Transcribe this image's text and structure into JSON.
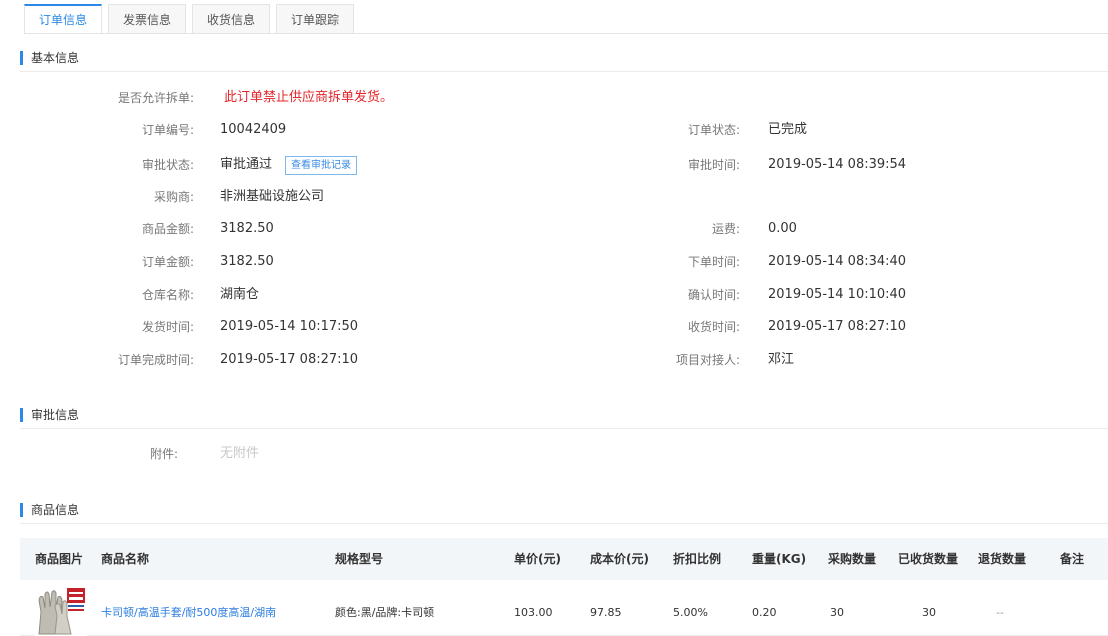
{
  "tabs": [
    "订单信息",
    "发票信息",
    "收货信息",
    "订单跟踪"
  ],
  "sections": {
    "basic": "基本信息",
    "approval": "审批信息",
    "goods": "商品信息"
  },
  "basic": {
    "split_label": "是否允许拆单:",
    "split_value": "此订单禁止供应商拆单发货。",
    "order_no_label": "订单编号:",
    "order_no_value": "10042409",
    "order_status_label": "订单状态:",
    "order_status_value": "已完成",
    "approval_status_label": "审批状态:",
    "approval_status_value": "审批通过",
    "approval_record_button": "查看审批记录",
    "approval_time_label": "审批时间:",
    "approval_time_value": "2019-05-14 08:39:54",
    "buyer_label": "采购商:",
    "buyer_value": "非洲基础设施公司",
    "goods_amount_label": "商品金额:",
    "goods_amount_value": "3182.50",
    "freight_label": "运费:",
    "freight_value": "0.00",
    "order_amount_label": "订单金额:",
    "order_amount_value": "3182.50",
    "order_time_label": "下单时间:",
    "order_time_value": "2019-05-14 08:34:40",
    "warehouse_label": "仓库名称:",
    "warehouse_value": "湖南仓",
    "confirm_time_label": "确认时间:",
    "confirm_time_value": "2019-05-14 10:10:40",
    "ship_time_label": "发货时间:",
    "ship_time_value": "2019-05-14 10:17:50",
    "receive_time_label": "收货时间:",
    "receive_time_value": "2019-05-17 08:27:10",
    "complete_time_label": "订单完成时间:",
    "complete_time_value": "2019-05-17 08:27:10",
    "contact_label": "项目对接人:",
    "contact_value": "邓江"
  },
  "approval": {
    "attachment_label": "附件:",
    "attachment_value": "无附件"
  },
  "goods_table": {
    "headers": [
      "商品图片",
      "商品名称",
      "规格型号",
      "单价(元)",
      "成本价(元)",
      "折扣比例",
      "重量(KG)",
      "采购数量",
      "已收货数量",
      "退货数量",
      "备注"
    ],
    "rows": [
      {
        "name": "卡司顿/高温手套/耐500度高温/湖南",
        "spec": "颜色:黑/品牌:卡司顿",
        "unit_price": "103.00",
        "cost_price": "97.85",
        "discount": "5.00%",
        "weight": "0.20",
        "purchase_qty": "30",
        "received_qty": "30",
        "return_qty": "--",
        "remark": ""
      }
    ]
  },
  "colors": {
    "accent": "#2b8ae6",
    "warning": "#e4262b",
    "link": "#2b7de0"
  }
}
